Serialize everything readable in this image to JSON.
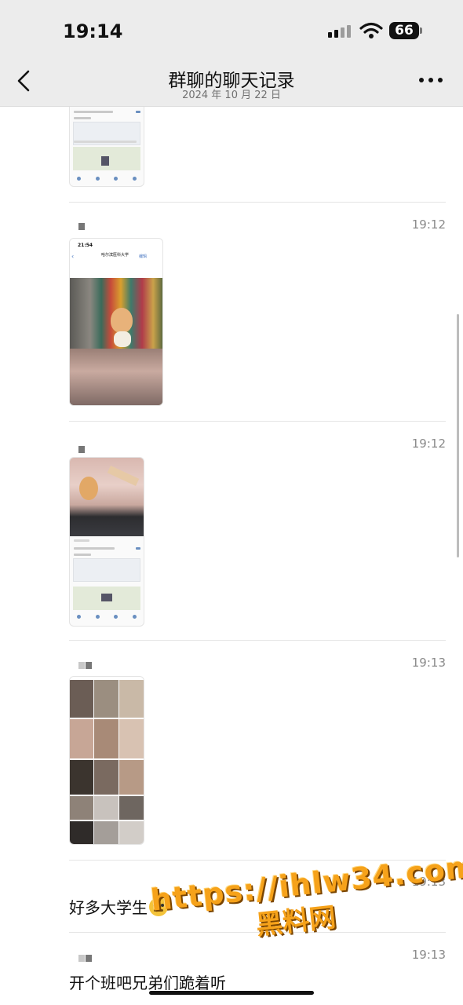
{
  "status_bar": {
    "time": "19:14",
    "battery": "66"
  },
  "header": {
    "title": "群聊的聊天记录",
    "subtitle": "2024 年 10 月 22 日"
  },
  "colors": {
    "header_bg": "#ececec",
    "accent_blue": "#4a78c2",
    "watermark_orange": "#f6a21a"
  },
  "icons": {
    "back": "chevron-left-icon",
    "more": "more-icon",
    "wifi": "wifi-icon",
    "signal": "signal-icon",
    "battery": "battery-icon"
  },
  "messages": [
    {
      "time": "19:12",
      "type": "image"
    },
    {
      "time": "19:12",
      "type": "image"
    },
    {
      "time": "19:13",
      "type": "image"
    },
    {
      "time": "19:13",
      "text": "好多大学生"
    },
    {
      "time": "19:13",
      "text": "开个班吧兄弟们跪着听"
    }
  ],
  "screenshot_2": {
    "time": "21:54",
    "title": "哈尔滨医科大学",
    "action": "编辑"
  },
  "watermark": {
    "url": "https://ihlw34.com",
    "name": "黑料网"
  }
}
